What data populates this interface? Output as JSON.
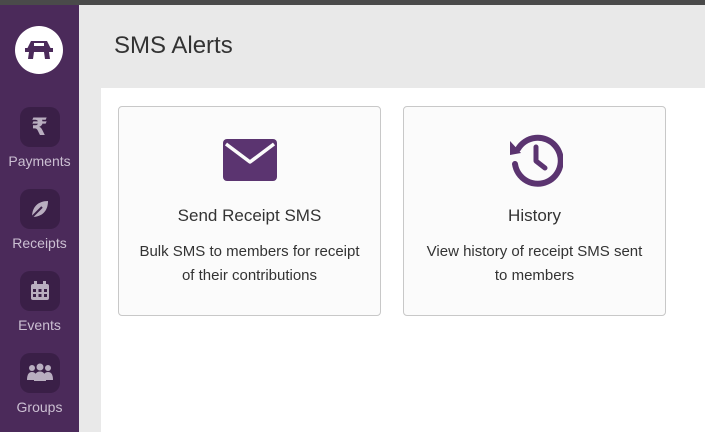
{
  "page": {
    "title": "SMS Alerts"
  },
  "sidebar": {
    "logo_icon": "app-logo-icon",
    "items": [
      {
        "label": "Payments",
        "icon": "rupee-icon"
      },
      {
        "label": "Receipts",
        "icon": "leaf-icon"
      },
      {
        "label": "Events",
        "icon": "calendar-icon"
      },
      {
        "label": "Groups",
        "icon": "users-icon"
      }
    ]
  },
  "cards": [
    {
      "title": "Send Receipt SMS",
      "description": "Bulk SMS to members for receipt of their contributions",
      "icon": "envelope-icon"
    },
    {
      "title": "History",
      "description": "View history of receipt SMS sent to members",
      "icon": "history-icon"
    }
  ],
  "colors": {
    "sidebar": "#4b2a5a",
    "accent": "#5b3470",
    "header_bg": "#e9e9e9"
  }
}
